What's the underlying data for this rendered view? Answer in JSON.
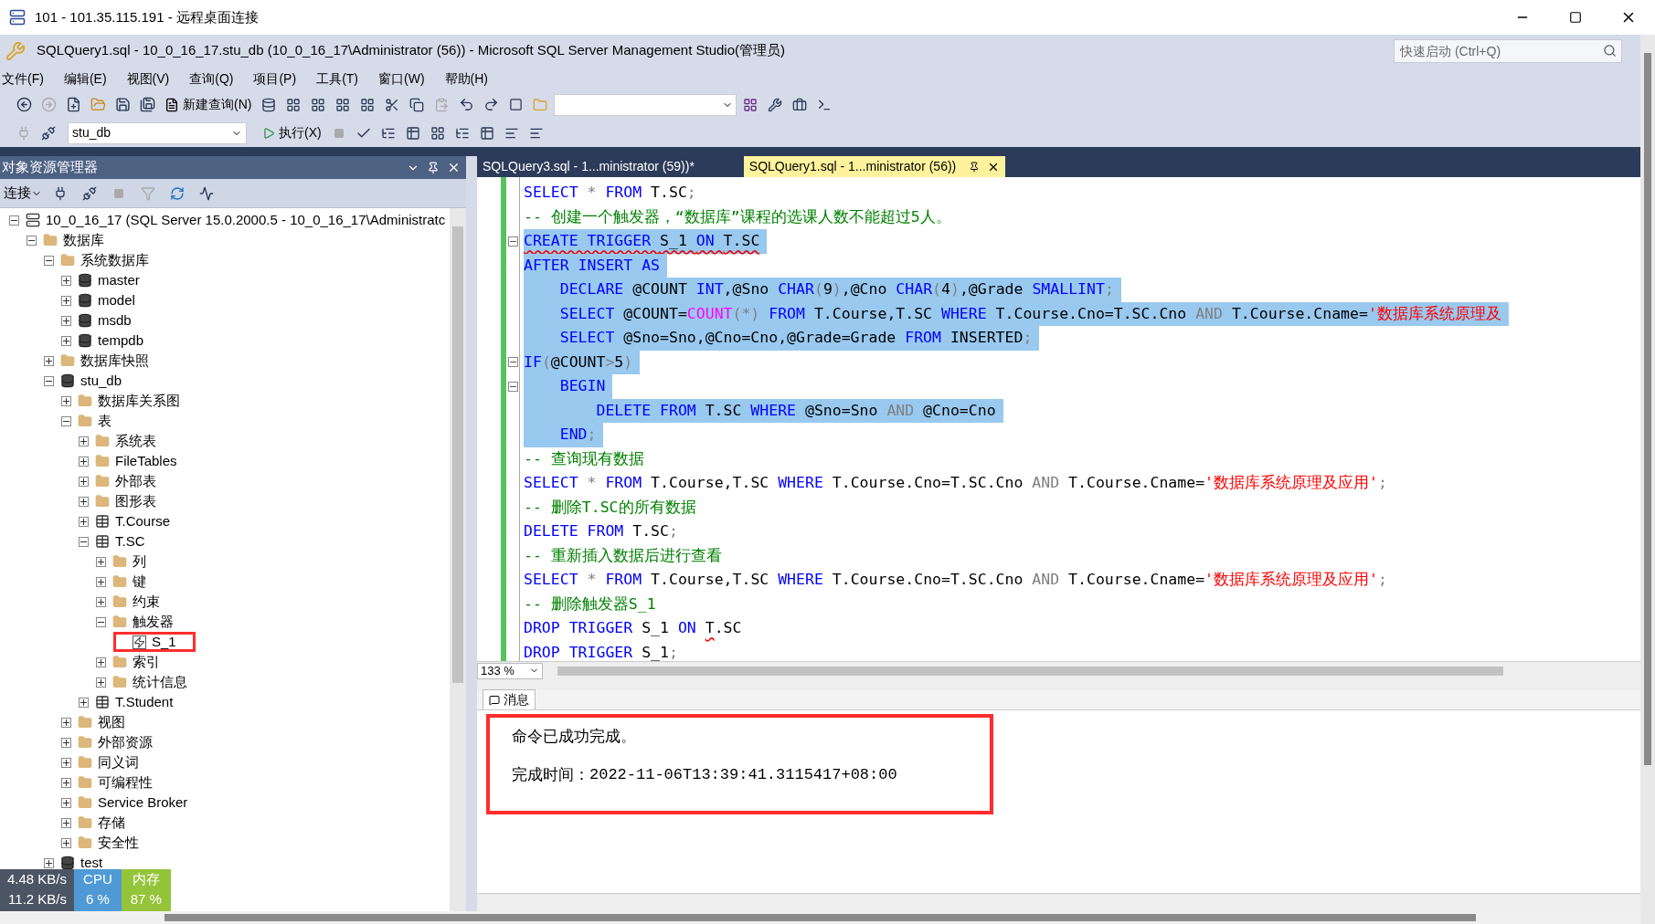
{
  "remote_window": {
    "title": "101 - 101.35.115.191 - 远程桌面连接"
  },
  "app": {
    "title": "SQLQuery1.sql - 10_0_16_17.stu_db (10_0_16_17\\Administrator (56)) - Microsoft SQL Server Management Studio(管理员)",
    "quick_launch": {
      "placeholder": "快速启动 (Ctrl+Q)"
    }
  },
  "menu": [
    "文件(F)",
    "编辑(E)",
    "视图(V)",
    "查询(Q)",
    "项目(P)",
    "工具(T)",
    "窗口(W)",
    "帮助(H)"
  ],
  "toolbar": {
    "new_query": "新建查询(N)",
    "database": "stu_db",
    "execute": "执行(X)"
  },
  "object_explorer": {
    "title": "对象资源管理器",
    "connect": "连接",
    "tree": [
      {
        "label": "10_0_16_17 (SQL Server 15.0.2000.5 - 10_0_16_17\\Administratc",
        "kind": "server",
        "expanded": true,
        "children": [
          {
            "label": "数据库",
            "kind": "folder",
            "expanded": true,
            "children": [
              {
                "label": "系统数据库",
                "kind": "folder",
                "expanded": true,
                "children": [
                  {
                    "label": "master",
                    "kind": "database",
                    "expanded": false
                  },
                  {
                    "label": "model",
                    "kind": "database",
                    "expanded": false
                  },
                  {
                    "label": "msdb",
                    "kind": "database",
                    "expanded": false
                  },
                  {
                    "label": "tempdb",
                    "kind": "database",
                    "expanded": false
                  }
                ]
              },
              {
                "label": "数据库快照",
                "kind": "folder",
                "expanded": false
              },
              {
                "label": "stu_db",
                "kind": "database",
                "expanded": true,
                "children": [
                  {
                    "label": "数据库关系图",
                    "kind": "folder",
                    "expanded": false
                  },
                  {
                    "label": "表",
                    "kind": "folder",
                    "expanded": true,
                    "children": [
                      {
                        "label": "系统表",
                        "kind": "folder",
                        "expanded": false
                      },
                      {
                        "label": "FileTables",
                        "kind": "folder",
                        "expanded": false
                      },
                      {
                        "label": "外部表",
                        "kind": "folder",
                        "expanded": false
                      },
                      {
                        "label": "图形表",
                        "kind": "folder",
                        "expanded": false
                      },
                      {
                        "label": "T.Course",
                        "kind": "table",
                        "expanded": false
                      },
                      {
                        "label": "T.SC",
                        "kind": "table",
                        "expanded": true,
                        "children": [
                          {
                            "label": "列",
                            "kind": "folder",
                            "expanded": false
                          },
                          {
                            "label": "键",
                            "kind": "folder",
                            "expanded": false
                          },
                          {
                            "label": "约束",
                            "kind": "folder",
                            "expanded": false
                          },
                          {
                            "label": "触发器",
                            "kind": "folder",
                            "expanded": true,
                            "children": [
                              {
                                "label": "S_1",
                                "kind": "trigger",
                                "highlighted": true
                              }
                            ]
                          },
                          {
                            "label": "索引",
                            "kind": "folder",
                            "expanded": false
                          },
                          {
                            "label": "统计信息",
                            "kind": "folder",
                            "expanded": false
                          }
                        ]
                      },
                      {
                        "label": "T.Student",
                        "kind": "table",
                        "expanded": false
                      }
                    ]
                  },
                  {
                    "label": "视图",
                    "kind": "folder",
                    "expanded": false
                  },
                  {
                    "label": "外部资源",
                    "kind": "folder",
                    "expanded": false
                  },
                  {
                    "label": "同义词",
                    "kind": "folder",
                    "expanded": false
                  },
                  {
                    "label": "可编程性",
                    "kind": "folder",
                    "expanded": false
                  },
                  {
                    "label": "Service Broker",
                    "kind": "folder",
                    "expanded": false
                  },
                  {
                    "label": "存储",
                    "kind": "folder",
                    "expanded": false
                  },
                  {
                    "label": "安全性",
                    "kind": "folder",
                    "expanded": false
                  }
                ]
              },
              {
                "label": "test",
                "kind": "database",
                "expanded": false
              }
            ]
          }
        ]
      }
    ]
  },
  "tabs": [
    {
      "label": "SQLQuery3.sql - 1...ministrator (59))*",
      "selected": false
    },
    {
      "label": "SQLQuery1.sql - 1...ministrator (56))",
      "selected": true
    }
  ],
  "editor": {
    "zoom": "133 %",
    "lines": [
      {
        "selected": false,
        "fold": false,
        "tokens": [
          {
            "kind": "keyword",
            "text": "SELECT"
          },
          {
            "kind": "operator",
            "text": " * "
          },
          {
            "kind": "keyword",
            "text": "FROM"
          },
          {
            "kind": "plain",
            "text": " T.SC"
          },
          {
            "kind": "operator",
            "text": ";"
          }
        ]
      },
      {
        "selected": false,
        "fold": false,
        "tokens": [
          {
            "kind": "comment",
            "text": "-- 创建一个触发器，“数据库”课程的选课人数不能超过5人。"
          }
        ]
      },
      {
        "selected": true,
        "fold": true,
        "tokens": [
          {
            "kind": "keyword",
            "text": "CREATE TRIGGER ",
            "error": true
          },
          {
            "kind": "plain",
            "text": "S_1 ",
            "error": true
          },
          {
            "kind": "keyword",
            "text": "ON ",
            "error": true
          },
          {
            "kind": "plain",
            "text": "T.SC",
            "error": true
          }
        ]
      },
      {
        "selected": true,
        "fold": false,
        "tokens": [
          {
            "kind": "keyword",
            "text": "AFTER INSERT AS"
          }
        ]
      },
      {
        "selected": true,
        "fold": false,
        "tokens": [
          {
            "kind": "keyword",
            "text": "    DECLARE"
          },
          {
            "kind": "plain",
            "text": " @COUNT "
          },
          {
            "kind": "keyword",
            "text": "INT"
          },
          {
            "kind": "plain",
            "text": ",@Sno "
          },
          {
            "kind": "keyword",
            "text": "CHAR"
          },
          {
            "kind": "operator",
            "text": "("
          },
          {
            "kind": "plain",
            "text": "9"
          },
          {
            "kind": "operator",
            "text": ")"
          },
          {
            "kind": "plain",
            "text": ",@Cno "
          },
          {
            "kind": "keyword",
            "text": "CHAR"
          },
          {
            "kind": "operator",
            "text": "("
          },
          {
            "kind": "plain",
            "text": "4"
          },
          {
            "kind": "operator",
            "text": ")"
          },
          {
            "kind": "plain",
            "text": ",@Grade "
          },
          {
            "kind": "keyword",
            "text": "SMALLINT"
          },
          {
            "kind": "operator",
            "text": ";"
          }
        ]
      },
      {
        "selected": true,
        "fold": false,
        "tokens": [
          {
            "kind": "keyword",
            "text": "    SELECT"
          },
          {
            "kind": "plain",
            "text": " @COUNT="
          },
          {
            "kind": "function",
            "text": "COUNT"
          },
          {
            "kind": "operator",
            "text": "(*)"
          },
          {
            "kind": "keyword",
            "text": " FROM"
          },
          {
            "kind": "plain",
            "text": " T.Course,T.SC "
          },
          {
            "kind": "keyword",
            "text": "WHERE"
          },
          {
            "kind": "plain",
            "text": " T.Course.Cno=T.SC.Cno "
          },
          {
            "kind": "operator",
            "text": "AND"
          },
          {
            "kind": "plain",
            "text": " T.Course.Cname="
          },
          {
            "kind": "string",
            "text": "'数据库系统原理及"
          }
        ]
      },
      {
        "selected": true,
        "fold": false,
        "tokens": [
          {
            "kind": "keyword",
            "text": "    SELECT"
          },
          {
            "kind": "plain",
            "text": " @Sno=Sno,@Cno=Cno,@Grade=Grade "
          },
          {
            "kind": "keyword",
            "text": "FROM"
          },
          {
            "kind": "plain",
            "text": " INSERTED"
          },
          {
            "kind": "operator",
            "text": ";"
          }
        ]
      },
      {
        "selected": true,
        "fold": true,
        "tokens": [
          {
            "kind": "keyword",
            "text": "IF"
          },
          {
            "kind": "operator",
            "text": "("
          },
          {
            "kind": "plain",
            "text": "@COUNT"
          },
          {
            "kind": "operator",
            "text": ">"
          },
          {
            "kind": "plain",
            "text": "5"
          },
          {
            "kind": "operator",
            "text": ")"
          }
        ]
      },
      {
        "selected": true,
        "fold": true,
        "tokens": [
          {
            "kind": "keyword",
            "text": "    BEGIN"
          }
        ]
      },
      {
        "selected": true,
        "fold": false,
        "tokens": [
          {
            "kind": "keyword",
            "text": "        DELETE FROM"
          },
          {
            "kind": "plain",
            "text": " T.SC "
          },
          {
            "kind": "keyword",
            "text": "WHERE"
          },
          {
            "kind": "plain",
            "text": " @Sno=Sno "
          },
          {
            "kind": "operator",
            "text": "AND"
          },
          {
            "kind": "plain",
            "text": " @Cno=Cno"
          }
        ]
      },
      {
        "selected": true,
        "fold": false,
        "tokens": [
          {
            "kind": "keyword",
            "text": "    END"
          },
          {
            "kind": "operator",
            "text": ";"
          }
        ]
      },
      {
        "selected": false,
        "fold": false,
        "tokens": [
          {
            "kind": "comment",
            "text": "-- 查询现有数据"
          }
        ]
      },
      {
        "selected": false,
        "fold": false,
        "tokens": [
          {
            "kind": "keyword",
            "text": "SELECT"
          },
          {
            "kind": "operator",
            "text": " * "
          },
          {
            "kind": "keyword",
            "text": "FROM"
          },
          {
            "kind": "plain",
            "text": " T.Course,T.SC "
          },
          {
            "kind": "keyword",
            "text": "WHERE"
          },
          {
            "kind": "plain",
            "text": " T.Course.Cno=T.SC.Cno "
          },
          {
            "kind": "operator",
            "text": "AND"
          },
          {
            "kind": "plain",
            "text": " T.Course.Cname="
          },
          {
            "kind": "string",
            "text": "'数据库系统原理及应用'"
          },
          {
            "kind": "operator",
            "text": ";"
          }
        ]
      },
      {
        "selected": false,
        "fold": false,
        "tokens": [
          {
            "kind": "comment",
            "text": "-- 删除T.SC的所有数据"
          }
        ]
      },
      {
        "selected": false,
        "fold": false,
        "tokens": [
          {
            "kind": "keyword",
            "text": "DELETE FROM"
          },
          {
            "kind": "plain",
            "text": " T.SC"
          },
          {
            "kind": "operator",
            "text": ";"
          }
        ]
      },
      {
        "selected": false,
        "fold": false,
        "tokens": [
          {
            "kind": "comment",
            "text": "-- 重新插入数据后进行查看"
          }
        ]
      },
      {
        "selected": false,
        "fold": false,
        "tokens": [
          {
            "kind": "keyword",
            "text": "SELECT"
          },
          {
            "kind": "operator",
            "text": " * "
          },
          {
            "kind": "keyword",
            "text": "FROM"
          },
          {
            "kind": "plain",
            "text": " T.Course,T.SC "
          },
          {
            "kind": "keyword",
            "text": "WHERE"
          },
          {
            "kind": "plain",
            "text": " T.Course.Cno=T.SC.Cno "
          },
          {
            "kind": "operator",
            "text": "AND"
          },
          {
            "kind": "plain",
            "text": " T.Course.Cname="
          },
          {
            "kind": "string",
            "text": "'数据库系统原理及应用'"
          },
          {
            "kind": "operator",
            "text": ";"
          }
        ]
      },
      {
        "selected": false,
        "fold": false,
        "tokens": [
          {
            "kind": "comment",
            "text": "-- 删除触发器S_1"
          }
        ]
      },
      {
        "selected": false,
        "fold": false,
        "tokens": [
          {
            "kind": "keyword",
            "text": "DROP TRIGGER"
          },
          {
            "kind": "plain",
            "text": " S_1 "
          },
          {
            "kind": "keyword",
            "text": "ON "
          },
          {
            "kind": "plain",
            "text": "T",
            "error": true
          },
          {
            "kind": "plain",
            "text": ".SC"
          }
        ]
      },
      {
        "selected": false,
        "fold": false,
        "tokens": [
          {
            "kind": "keyword",
            "text": "DROP TRIGGER"
          },
          {
            "kind": "plain",
            "text": " S_1"
          },
          {
            "kind": "operator",
            "text": ";"
          }
        ]
      }
    ]
  },
  "results": {
    "tab": "消息",
    "highlighted": true,
    "message": "命令已成功完成。",
    "time_label": "完成时间：",
    "time": "2022-11-06T13:39:41.3115417+08:00"
  },
  "net_monitor": {
    "upload": "4.48 KB/s",
    "download": "11.2 KB/s",
    "cpu_label": "CPU",
    "cpu": "6 %",
    "mem_label": "内存",
    "mem": "87 %"
  }
}
